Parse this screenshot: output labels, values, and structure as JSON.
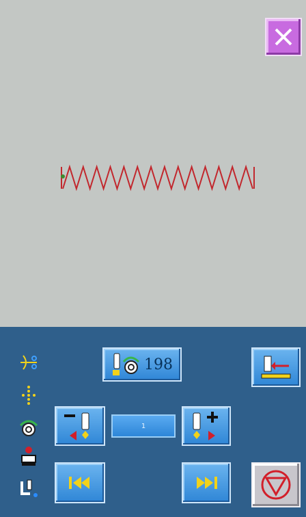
{
  "window": {
    "close_icon": "close-icon"
  },
  "pattern": {
    "type": "zigzag",
    "peaks": 14,
    "color": "#c2272d"
  },
  "panel": {
    "left_icons": [
      "thread-trim-icon",
      "stitch-path-icon",
      "bobbin-icon",
      "presser-foot-icon",
      "needle-position-icon"
    ],
    "speed": {
      "icon": "needle-speed-icon",
      "value": "198"
    },
    "origin_icon": "return-origin-icon",
    "step_back_icon": "needle-step-back-icon",
    "step_value": "1",
    "step_forward_icon": "needle-step-forward-icon",
    "first_icon": "skip-first-icon",
    "last_icon": "skip-last-icon",
    "stop_icon": "stop-icon"
  },
  "colors": {
    "panel": "#2f5f8b",
    "button": "#3f95de",
    "close": "#c86be0",
    "stitch": "#c2272d"
  }
}
